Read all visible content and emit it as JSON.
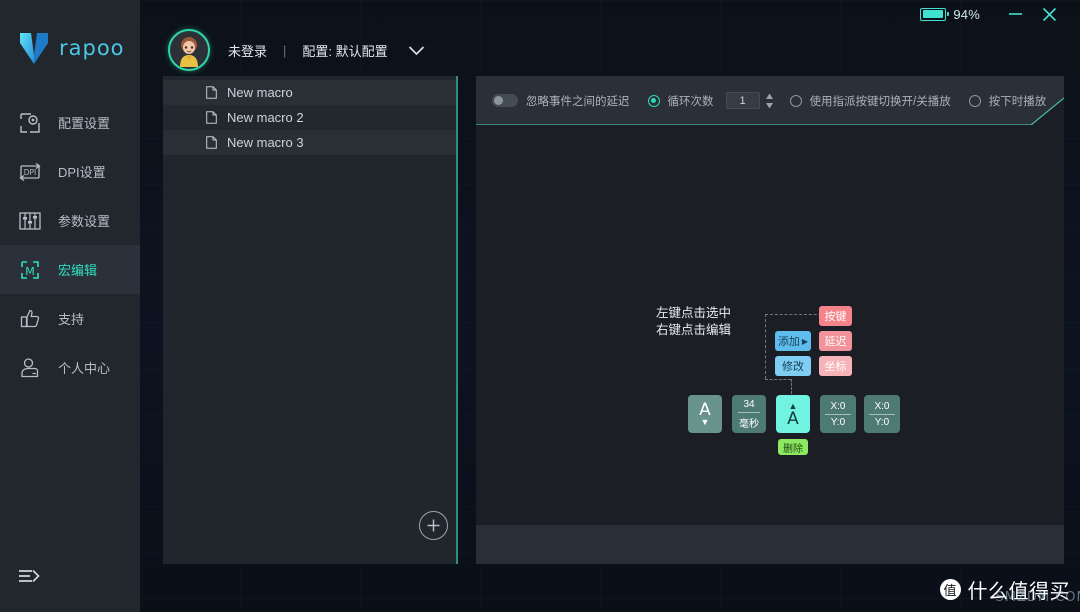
{
  "titlebar": {
    "battery_percent": "94%",
    "battery_level": 94,
    "minimize_icon": "minimize-icon",
    "close_icon": "close-icon",
    "accent": "#3fe0d0"
  },
  "sidebar": {
    "brand": "rapoo",
    "logo_icon": "rapoo-v-logo",
    "collapse_icon": "expand-panel-icon",
    "items": [
      {
        "label": "配置设置",
        "icon": "profile-settings-icon",
        "active": false
      },
      {
        "label": "DPI设置",
        "icon": "dpi-settings-icon",
        "active": false
      },
      {
        "label": "参数设置",
        "icon": "parameter-settings-icon",
        "active": false
      },
      {
        "label": "宏编辑",
        "icon": "macro-editor-icon",
        "active": true
      },
      {
        "label": "支持",
        "icon": "thumbs-up-icon",
        "active": false
      },
      {
        "label": "个人中心",
        "icon": "user-profile-icon",
        "active": false
      }
    ],
    "active_color": "#2fe0bd"
  },
  "header": {
    "avatar_icon": "user-avatar",
    "login_status": "未登录",
    "separator": "|",
    "profile_label": "配置: 默认配置",
    "chevron_icon": "chevron-down-icon"
  },
  "macro_panel": {
    "items": [
      {
        "name": "New macro",
        "icon": "document-icon"
      },
      {
        "name": "New macro 2",
        "icon": "document-icon"
      },
      {
        "name": "New macro 3",
        "icon": "document-icon"
      }
    ],
    "add_button_icon": "plus-circle-icon"
  },
  "toolbar": {
    "ignore_delay_label": "忽略事件之间的延迟",
    "ignore_delay_on": false,
    "loop_count_label": "循环次数",
    "loop_count_selected": true,
    "loop_count_value": "1",
    "spinner_icon": "spinner-arrows-icon",
    "toggle_play_label": "使用指派按键切换开/关播放",
    "toggle_play_selected": false,
    "press_play_label": "按下时播放",
    "press_play_selected": false
  },
  "canvas": {
    "hint_line1": "左键点击选中",
    "hint_line2": "右键点击编辑",
    "action_buttons": [
      {
        "label": "添加",
        "arrow": "▶",
        "name": "add-action-button"
      },
      {
        "label": "修改",
        "arrow": "",
        "name": "modify-action-button"
      }
    ],
    "type_buttons": [
      {
        "label": "按键",
        "color": "#f4838a",
        "name": "key-type-button"
      },
      {
        "label": "延迟",
        "color": "#f2929a",
        "name": "delay-type-button"
      },
      {
        "label": "坐标",
        "color": "#f6b3b8",
        "name": "coordinate-type-button"
      }
    ],
    "events": [
      {
        "type": "key",
        "key": "A",
        "arrow": "▼",
        "selected": false
      },
      {
        "type": "delay",
        "value": "34",
        "unit": "毫秒",
        "selected": false
      },
      {
        "type": "key",
        "key": "A",
        "arrow": "▲",
        "selected": true
      },
      {
        "type": "coord",
        "x": "X:0",
        "y": "Y:0",
        "selected": false
      },
      {
        "type": "coord",
        "x": "X:0",
        "y": "Y:0",
        "selected": false
      }
    ],
    "delete_label": "删除"
  },
  "watermark": {
    "badge": "值",
    "text": "什么值得买",
    "sub": "SMZDM.COM"
  }
}
